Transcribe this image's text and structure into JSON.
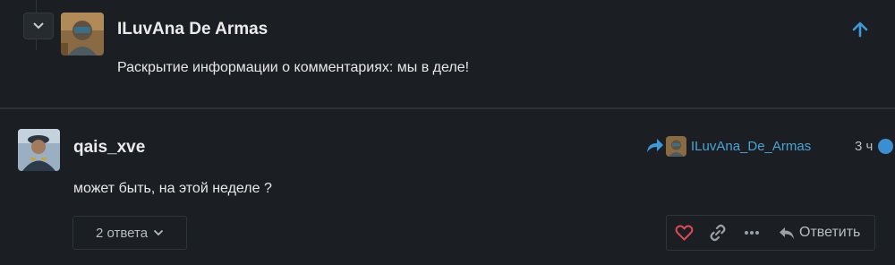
{
  "parent_comment": {
    "username": "ILuvAna De Armas",
    "text": "Раскрытие информации о комментариях: мы в деле!"
  },
  "comment": {
    "username": "qais_xve",
    "reply_to": "ILuvAna_De_Armas",
    "time": "3 ч",
    "text": "может быть, на этой неделе ?",
    "replies_label": "2 ответа",
    "reply_action_label": "Ответить"
  },
  "colors": {
    "background": "#1b1f23",
    "link": "#4aa3d6",
    "like_heart": "#e04a55",
    "accent": "#3b8fd0"
  },
  "icons": [
    "chevron-down-icon",
    "arrow-up-icon",
    "reply-arrow-icon",
    "heart-icon",
    "link-icon",
    "more-icon",
    "reply-icon"
  ]
}
